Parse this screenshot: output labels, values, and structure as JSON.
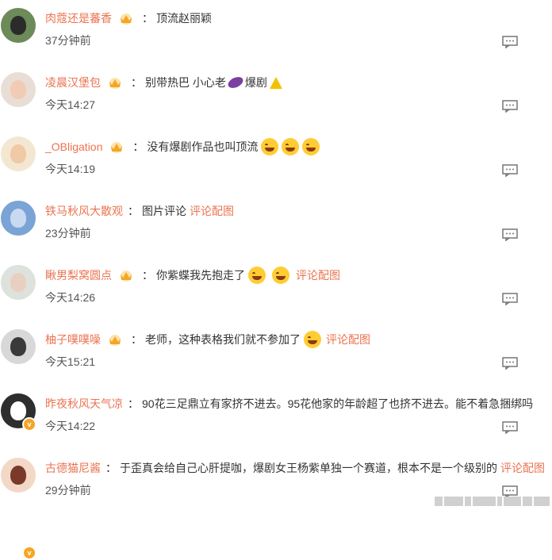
{
  "colors": {
    "username": "#eb7350",
    "text": "#333333",
    "time": "#555555",
    "crown": "#f5a623"
  },
  "comments": [
    {
      "username": "肉蔻还是蕃香",
      "has_crown": true,
      "text": "顶流赵丽颖",
      "time": "37分钟前",
      "avatar": "dark-character",
      "verified": false
    },
    {
      "username": "凌晨汉堡包",
      "has_crown": true,
      "text": "别带热巴 小心老",
      "text_after_emoji": "爆剧",
      "emoji": [
        "eggplant-emoji",
        "warning-emoji"
      ],
      "time": "今天14:27",
      "avatar": "girl-portrait",
      "verified": false
    },
    {
      "username": "_OBligation",
      "has_crown": true,
      "text": "没有爆剧作品也叫顶流",
      "emoji": [
        "laugh-cry-emoji",
        "laugh-cry-emoji",
        "laugh-cry-emoji"
      ],
      "time": "今天14:19",
      "avatar": "cartoon-girl",
      "verified": false
    },
    {
      "username": "铁马秋风大散观",
      "has_crown": false,
      "text": "图片评论",
      "link": "评论配图",
      "time": "23分钟前",
      "avatar": "crowd-photo",
      "verified": false
    },
    {
      "username": "瞅男梨窝圆点",
      "has_crown": true,
      "text": "你紫蝶我先抱走了",
      "emoji": [
        "laugh-emoji",
        "laugh-emoji"
      ],
      "link": "评论配图",
      "time": "今天14:26",
      "avatar": "girl-sketch",
      "verified": true
    },
    {
      "username": "柚子噗噗噪",
      "has_crown": true,
      "text": "老师，这种表格我们就不参加了",
      "emoji": [
        "tearful-emoji"
      ],
      "link": "评论配图",
      "time": "今天15:21",
      "avatar": "girl-bw",
      "verified": false
    },
    {
      "username": "昨夜秋风天气凉",
      "has_crown": false,
      "text": "90花三足鼎立有家挤不进去。95花他家的年龄超了也挤不进去。能不着急捆绑吗",
      "time": "今天14:22",
      "avatar": "panda-character",
      "verified": true
    },
    {
      "username": "古德猫尼酱",
      "has_crown": false,
      "text": "于歪真会给自己心肝提咖，爆剧女王杨紫单独一个赛道，根本不是一个级别的",
      "link": "评论配图",
      "time": "29分钟前",
      "avatar": "anime-girl",
      "verified": false
    }
  ]
}
